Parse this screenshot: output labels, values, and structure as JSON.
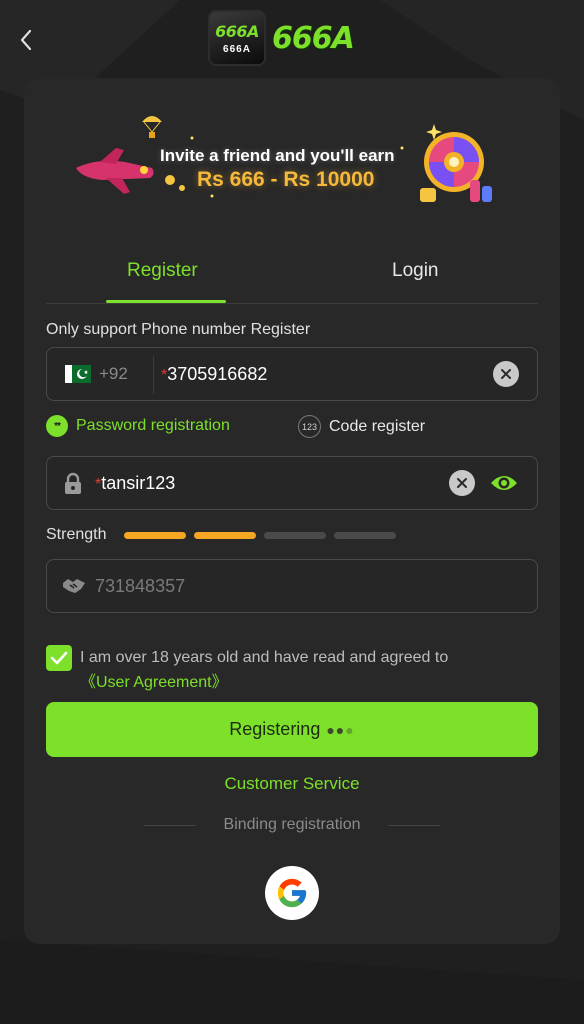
{
  "header": {
    "back_icon": "chevron-left-icon",
    "logo_badge_big": "666A",
    "logo_badge_small": "666A",
    "logo_text": "666A"
  },
  "banner": {
    "line1": "Invite a friend and you'll earn",
    "line2": "Rs 666 - Rs 10000"
  },
  "tabs": [
    {
      "label": "Register",
      "active": true
    },
    {
      "label": "Login",
      "active": false
    }
  ],
  "register_hint": "Only support Phone number Register",
  "phone": {
    "country_code": "+92",
    "required_mark": "*",
    "value": "3705916682",
    "clear_icon": "clear-circle-icon"
  },
  "modes": {
    "password_badge": "**",
    "password_label": "Password registration",
    "code_badge": "123",
    "code_label": "Code register"
  },
  "password": {
    "required_mark": "*",
    "value": "tansir123",
    "lock_icon": "lock-icon",
    "eye_icon": "eye-icon"
  },
  "strength": {
    "label": "Strength",
    "level": 2,
    "segments": 4
  },
  "invite": {
    "placeholder": "731848357",
    "icon": "handshake-icon"
  },
  "agreement": {
    "checked": true,
    "text": "I am over 18 years old and have read and agreed to",
    "link": "《User Agreement》"
  },
  "submit_label": "Registering",
  "customer_service": "Customer Service",
  "binding_label": "Binding registration",
  "colors": {
    "accent": "#7de02a",
    "strength_on": "#f5a623",
    "strength_off": "#4a4a4a",
    "card": "#282828",
    "background": "#1f1f1f"
  }
}
